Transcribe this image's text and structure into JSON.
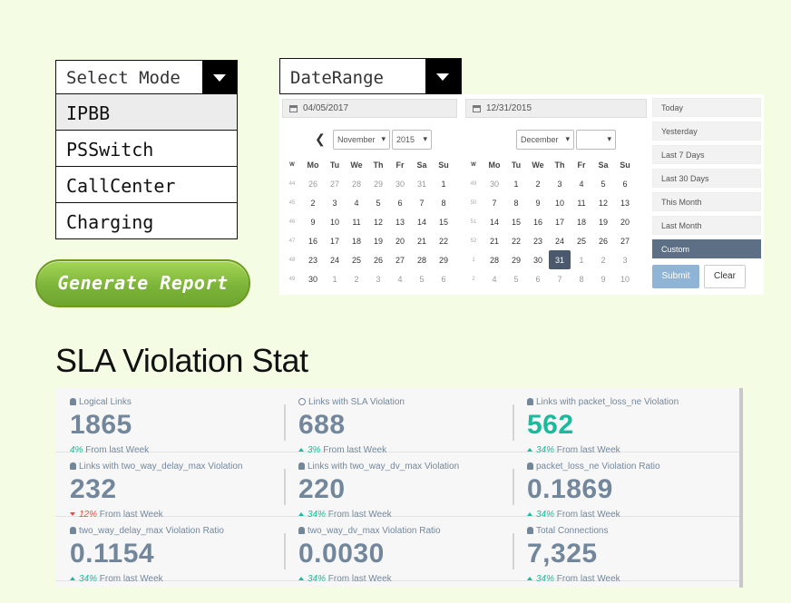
{
  "mode_select": {
    "label": "Select Mode",
    "options": [
      "IPBB",
      "PSSwitch",
      "CallCenter",
      "Charging"
    ]
  },
  "generate_button": "Generate Report",
  "date_range_select": {
    "label": "DateRange"
  },
  "date_picker": {
    "start_date": "04/05/2017",
    "end_date": "12/31/2015",
    "left_calendar": {
      "month": "November",
      "year": "2015",
      "dow": [
        "W",
        "Mo",
        "Tu",
        "We",
        "Th",
        "Fr",
        "Sa",
        "Su"
      ],
      "weeks": [
        [
          "44",
          "26",
          "27",
          "28",
          "29",
          "30",
          "31",
          "1"
        ],
        [
          "45",
          "2",
          "3",
          "4",
          "5",
          "6",
          "7",
          "8"
        ],
        [
          "46",
          "9",
          "10",
          "11",
          "12",
          "13",
          "14",
          "15"
        ],
        [
          "47",
          "16",
          "17",
          "18",
          "19",
          "20",
          "21",
          "22"
        ],
        [
          "48",
          "23",
          "24",
          "25",
          "26",
          "27",
          "28",
          "29"
        ],
        [
          "49",
          "30",
          "1",
          "2",
          "3",
          "4",
          "5",
          "6"
        ]
      ]
    },
    "right_calendar": {
      "month": "December",
      "year": "",
      "dow": [
        "W",
        "Mo",
        "Tu",
        "We",
        "Th",
        "Fr",
        "Sa",
        "Su"
      ],
      "weeks": [
        [
          "49",
          "30",
          "1",
          "2",
          "3",
          "4",
          "5",
          "6"
        ],
        [
          "50",
          "7",
          "8",
          "9",
          "10",
          "11",
          "12",
          "13"
        ],
        [
          "51",
          "14",
          "15",
          "16",
          "17",
          "18",
          "19",
          "20"
        ],
        [
          "52",
          "21",
          "22",
          "23",
          "24",
          "25",
          "26",
          "27"
        ],
        [
          "1",
          "28",
          "29",
          "30",
          "31",
          "1",
          "2",
          "3"
        ],
        [
          "2",
          "4",
          "5",
          "6",
          "7",
          "8",
          "9",
          "10"
        ]
      ],
      "selected_day": "31"
    },
    "ranges": [
      "Today",
      "Yesterday",
      "Last 7 Days",
      "Last 30 Days",
      "This Month",
      "Last Month",
      "Custom"
    ],
    "active_range": "Custom",
    "submit_label": "Submit",
    "clear_label": "Clear"
  },
  "sla": {
    "title": "SLA Violation Stat",
    "stats": [
      {
        "caption": "Logical Links",
        "icon": "user-icon",
        "value": "1865",
        "change": "4%",
        "direction": "none",
        "footer": "From last Week"
      },
      {
        "caption": "Links with SLA Violation",
        "icon": "clock-icon",
        "value": "688",
        "change": "3%",
        "direction": "up",
        "footer": "From last Week"
      },
      {
        "caption": "Links with packet_loss_ne Violation",
        "icon": "user-icon",
        "value": "562",
        "change": "34%",
        "direction": "up",
        "footer": "From last Week",
        "highlight": "#1abb9c"
      },
      {
        "caption": "Links with two_way_delay_max Violation",
        "icon": "user-icon",
        "value": "232",
        "change": "12%",
        "direction": "down",
        "footer": "From last Week"
      },
      {
        "caption": "Links with two_way_dv_max Violation",
        "icon": "user-icon",
        "value": "220",
        "change": "34%",
        "direction": "up",
        "footer": "From last Week"
      },
      {
        "caption": "packet_loss_ne Violation Ratio",
        "icon": "user-icon",
        "value": "0.1869",
        "change": "34%",
        "direction": "up",
        "footer": "From last Week"
      },
      {
        "caption": "two_way_delay_max Violation Ratio",
        "icon": "user-icon",
        "value": "0.1154",
        "change": "34%",
        "direction": "up",
        "footer": "From last Week"
      },
      {
        "caption": "two_way_dv_max Violation Ratio",
        "icon": "user-icon",
        "value": "0.0030",
        "change": "34%",
        "direction": "up",
        "footer": "From last Week"
      },
      {
        "caption": "Total Connections",
        "icon": "user-icon",
        "value": "7,325",
        "change": "34%",
        "direction": "up",
        "footer": "From last Week"
      }
    ]
  }
}
